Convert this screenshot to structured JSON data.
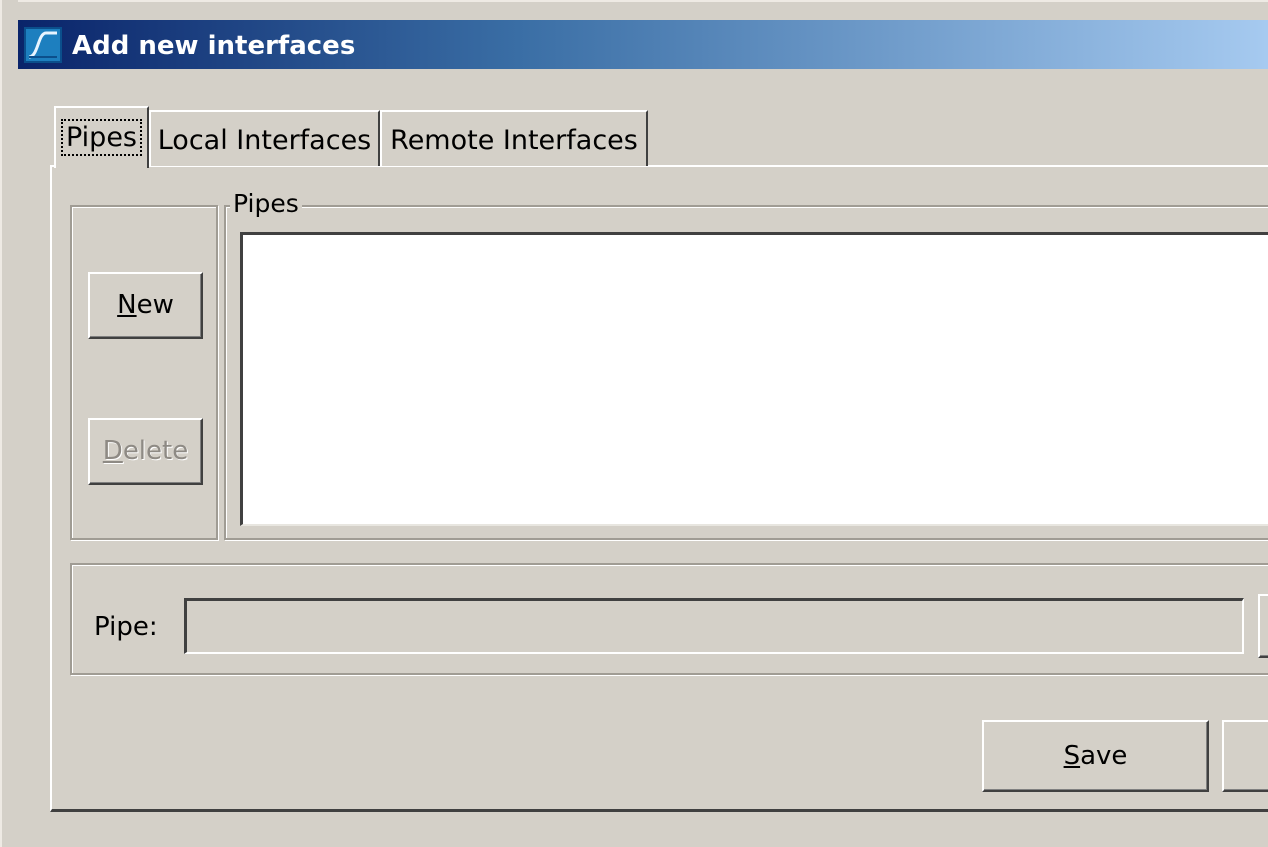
{
  "window": {
    "title": "Add new interfaces",
    "icon": "wireshark-fin-icon"
  },
  "tabs": [
    {
      "label": "Pipes",
      "selected": true
    },
    {
      "label": "Local Interfaces",
      "selected": false
    },
    {
      "label": "Remote Interfaces",
      "selected": false
    }
  ],
  "pipes_section": {
    "legend": "Pipes",
    "items": []
  },
  "buttons": {
    "new": {
      "accel": "N",
      "rest": "ew",
      "enabled": true
    },
    "delete": {
      "accel": "D",
      "rest": "elete",
      "enabled": false
    },
    "save": {
      "accel": "S",
      "rest": "ave"
    }
  },
  "pipe_field": {
    "label": "Pipe:",
    "value": "",
    "enabled": false
  },
  "colors": {
    "titlebar_start": "#0a246a",
    "titlebar_end": "#a6caf0",
    "face": "#d4d0c8"
  }
}
